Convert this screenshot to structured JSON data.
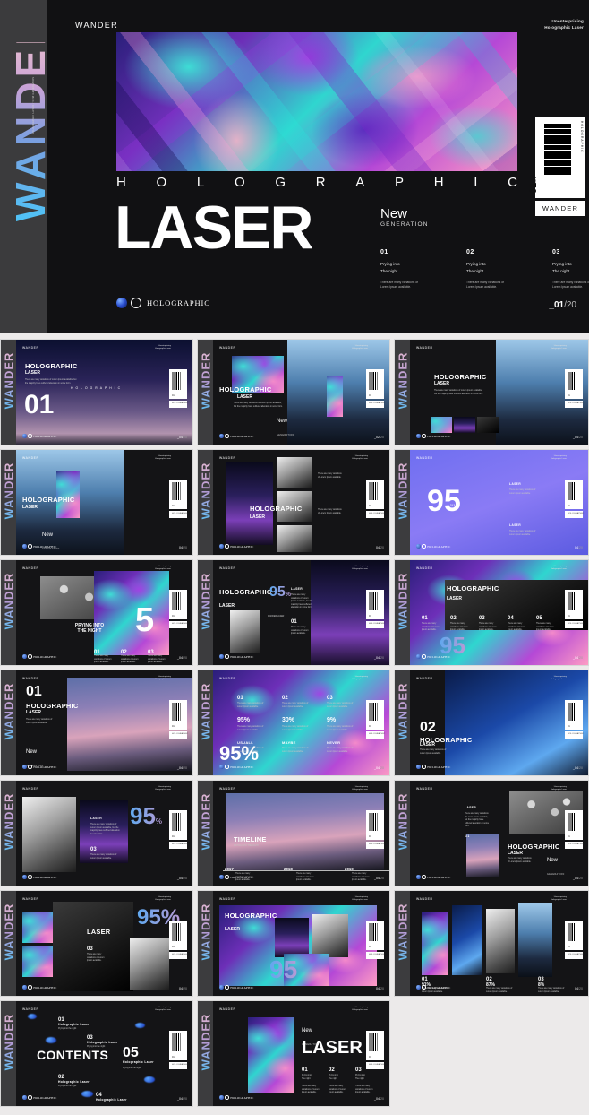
{
  "hero": {
    "brand": "WANDER",
    "vertical_brand": "WANDER",
    "micro_text": "HOLOGRAPHIC LASER / NEW GENERATION",
    "tagline_line1": "Unenterprising",
    "tagline_line2": "Holographic Laser",
    "holographic_word": "HOLOGRAPHIC",
    "title": "LASER",
    "new_label": "New",
    "new_sub": "GENERATION",
    "columns": [
      {
        "number": "01",
        "line1": "Prying into",
        "line2": "The night",
        "body": "There are many variations of Lorem Ipsum available."
      },
      {
        "number": "02",
        "line1": "Prying into",
        "line2": "The night",
        "body": "There are many variations of Lorem Ipsum available."
      },
      {
        "number": "03",
        "line1": "Prying into",
        "line2": "The night",
        "body": "There are many variations of Lorem Ipsum available."
      }
    ],
    "logo_text": "HOLOGRAPHIC",
    "page_current": "_01",
    "page_total": "/20",
    "barcode_label": "HOLOGRAPHIC",
    "barcode_number": "01",
    "barcode_sup": "ON",
    "barcode_card_label": "WANDER"
  },
  "colors": {
    "background": "#111113",
    "sidebar": "#3b3b3d",
    "accent_cyan": "#4fc3f7",
    "accent_pink": "#e7bcd0",
    "accent_purple": "#9a5ce0",
    "page_bg": "#eceaea"
  },
  "common": {
    "brand": "WANDER",
    "tagline_line1": "Unenterprising",
    "tagline_line2": "Holographic Laser",
    "logo_text": "HOLOGRAPHIC",
    "page_current": "_04",
    "page_total": "/20",
    "barcode_small": "HOLOGRAPHIC",
    "title_holographic": "HOLOGRAPHIC",
    "title_laser": "LASER",
    "lorem_short": "There are many variations of Lorem Ipsum available.",
    "lorem_long": "There are many variations of Lorem Ipsum available, but the majority have suffered alteration in some form."
  },
  "slides": [
    {
      "id": "s01",
      "headline": "HOLOGRAPHIC",
      "headline2": "LASER",
      "big": "01",
      "spaced": "HOLOGRAPHIC",
      "page": "_04"
    },
    {
      "id": "s02",
      "headline": "HOLOGRAPHIC",
      "headline2": "LASER",
      "new_label": "New",
      "new_sub": "GENERATION",
      "page": "_02"
    },
    {
      "id": "s03",
      "headline": "HOLOGRAPHIC",
      "headline2": "LASER",
      "page": "_04"
    },
    {
      "id": "s04",
      "headline": "HOLOGRAPHIC",
      "headline2": "LASER",
      "page": "_04"
    },
    {
      "id": "s05",
      "big": "95",
      "label": "LASER",
      "sub": "1/1",
      "page": "_04"
    },
    {
      "id": "s06",
      "big": "5",
      "overlay1": "PRYING INTO",
      "overlay2": "THE NIGHT",
      "page": "_04"
    },
    {
      "id": "s07",
      "headline": "HOLOGRAPHIC",
      "headline2": "LASER",
      "pct": "95",
      "pct_sym": "%",
      "label": "LASER",
      "sub": "WANDER LASER",
      "num": "01",
      "page": "_04"
    },
    {
      "id": "s08",
      "headline": "HOLOGRAPHIC",
      "headline2": "LASER",
      "steps": [
        "01",
        "02",
        "03",
        "04",
        "05"
      ],
      "big": "95",
      "page": "_04"
    },
    {
      "id": "s09",
      "big": "01",
      "headline": "HOLOGRAPHIC",
      "headline2": "LASER",
      "new_label": "New",
      "new_sub": "GENERATION",
      "page": "_04"
    },
    {
      "id": "s10",
      "big": "95",
      "big_sym": "%",
      "items": [
        {
          "n": "01",
          "pct": "95%",
          "label": "USUALL"
        },
        {
          "n": "02",
          "pct": "30%",
          "label": "MAYBE"
        },
        {
          "n": "03",
          "pct": "9%",
          "label": "NEVER"
        }
      ],
      "page": "_04"
    },
    {
      "id": "s11",
      "big": "02",
      "headline": "HOLOGRAPHIC",
      "headline2": "LASER",
      "page": "_04"
    },
    {
      "id": "s12",
      "headline": "HOLOGRAPHIC",
      "headline2": "LASER",
      "new_label": "New",
      "new_sub": "GENERATION",
      "label": "LASER",
      "page": "_04"
    },
    {
      "id": "s13",
      "headline": "LASER",
      "big": "95",
      "big_sym": "%",
      "num": "03",
      "page": "_04"
    },
    {
      "id": "s14",
      "title": "TIMELINE",
      "subtitle": "PRYING INTO THE NIGHT",
      "years": [
        "2017",
        "2018",
        "2019"
      ],
      "page": "_04"
    },
    {
      "id": "s15",
      "label": "LASER",
      "sub": "1/1",
      "headline": "HOLOGRAPHIC",
      "headline2": "LASER",
      "new_label": "New",
      "new_sub": "GENERATION",
      "page": "_04"
    },
    {
      "id": "s16",
      "headline": "HOLOGRAPHIC",
      "headline2": "LASER",
      "big": "95",
      "page": "_04"
    },
    {
      "id": "s17",
      "items": [
        {
          "n": "01",
          "pct": "91%"
        },
        {
          "n": "02",
          "pct": "87%"
        },
        {
          "n": "03",
          "pct": "8%"
        }
      ],
      "page": "_04"
    },
    {
      "id": "s18",
      "title": "CONTENTS",
      "entries": [
        {
          "n": "01",
          "label": "Holographic Laser",
          "sub": "Prying into the night"
        },
        {
          "n": "02",
          "label": "Holographic Laser",
          "sub": "Prying into the night"
        },
        {
          "n": "03",
          "label": "Holographic Laser",
          "sub": "Prying into the night"
        },
        {
          "n": "04",
          "label": "Holographic Laser",
          "sub": "Prying into the night"
        },
        {
          "n": "05",
          "label": "Holographic Laser",
          "sub": "Prying into the night"
        }
      ],
      "big": "05",
      "page": "_04"
    },
    {
      "id": "s19",
      "new_label": "New",
      "new_sub": "GENERATION",
      "title": "LASER",
      "columns": [
        {
          "n": "01",
          "l1": "Prying into",
          "l2": "The night"
        },
        {
          "n": "02",
          "l1": "Prying into",
          "l2": "The night"
        },
        {
          "n": "03",
          "l1": "Prying into",
          "l2": "The night"
        }
      ],
      "page": "_04"
    }
  ]
}
